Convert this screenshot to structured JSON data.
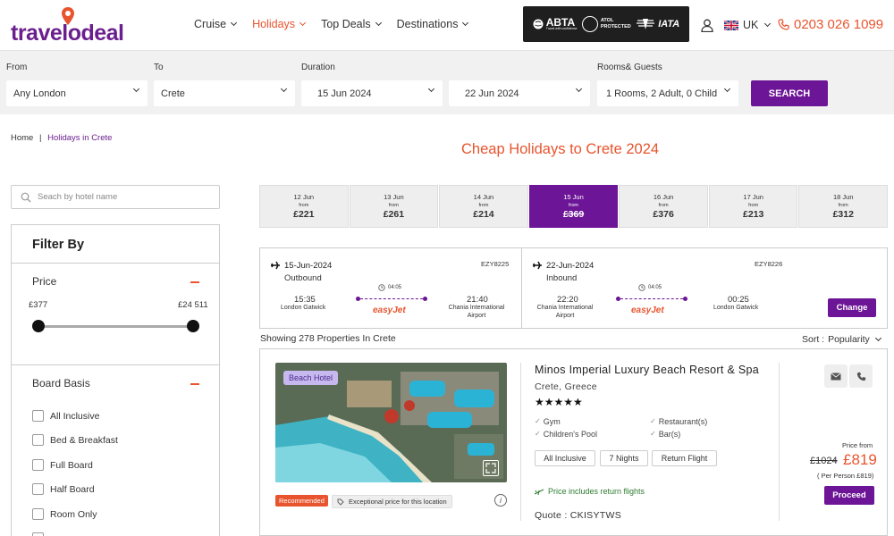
{
  "brand": {
    "logo_text": "travelodeal"
  },
  "nav": [
    {
      "label": "Cruise",
      "active": false
    },
    {
      "label": "Holidays",
      "active": true
    },
    {
      "label": "Top Deals",
      "active": false
    },
    {
      "label": "Destinations",
      "active": false
    }
  ],
  "badges": {
    "abta": "ABTA",
    "abta_sub": "Travel with confidence",
    "atol_line1": "ATOL",
    "atol_line2": "PROTECTED",
    "iata": "IATA"
  },
  "region": "UK",
  "phone": "0203 026 1099",
  "search": {
    "from_label": "From",
    "from_value": "Any London",
    "to_label": "To",
    "to_value": "Crete",
    "duration_label": "Duration",
    "depart_value": "15 Jun 2024",
    "return_value": "22 Jun 2024",
    "rooms_label": "Rooms& Guests",
    "rooms_value": "1 Rooms, 2 Adult, 0 Child",
    "button": "SEARCH"
  },
  "breadcrumb": {
    "home": "Home",
    "sep": "|",
    "current": "Holidays in Crete"
  },
  "hotel_search_placeholder": "Seach by hotel name",
  "filters": {
    "title": "Filter By",
    "price_title": "Price",
    "price_min": "£377",
    "price_max": "£24 511",
    "board_title": "Board Basis",
    "board_options": [
      "All Inclusive",
      "Bed & Breakfast",
      "Full Board",
      "Half Board",
      "Room Only"
    ]
  },
  "page_title": "Cheap Holidays to Crete 2024",
  "dates": [
    {
      "date": "12 Jun",
      "from": "from",
      "price": "£221",
      "active": false
    },
    {
      "date": "13 Jun",
      "from": "from",
      "price": "£261",
      "active": false
    },
    {
      "date": "14 Jun",
      "from": "from",
      "price": "£214",
      "active": false
    },
    {
      "date": "15 Jun",
      "from": "from",
      "price": "£369",
      "active": true
    },
    {
      "date": "16 Jun",
      "from": "from",
      "price": "£376",
      "active": false
    },
    {
      "date": "17 Jun",
      "from": "from",
      "price": "£213",
      "active": false
    },
    {
      "date": "18 Jun",
      "from": "from",
      "price": "£312",
      "active": false
    }
  ],
  "outbound": {
    "date": "15-Jun-2024",
    "direction": "Outbound",
    "code": "EZY8225",
    "dep_time": "15:35",
    "dep_place": "London Gatwick",
    "duration": "04:05",
    "airline": "easyJet",
    "arr_time": "21:40",
    "arr_place_1": "Chania International",
    "arr_place_2": "Airport"
  },
  "inbound": {
    "date": "22-Jun-2024",
    "direction": "Inbound",
    "code": "EZY8226",
    "dep_time": "22:20",
    "dep_place_1": "Chania International",
    "dep_place_2": "Airport",
    "duration": "04:05",
    "airline": "easyJet",
    "arr_time": "00:25",
    "arr_place": "London Gatwick",
    "change": "Change"
  },
  "results": {
    "showing": "Showing 278 Properties In Crete",
    "sort_label": "Sort :",
    "sort_value": "Popularity"
  },
  "hotel": {
    "tag": "Beach Hotel",
    "recommended": "Recommended",
    "exceptional": "Exceptional price for this location",
    "name": "Minos Imperial Luxury Beach Resort & Spa",
    "location": "Crete, Greece",
    "stars": "★★★★★",
    "amenities": [
      "Gym",
      "Restaurant(s)",
      "Children's Pool",
      "Bar(s)"
    ],
    "pills": [
      "All Inclusive",
      "7 Nights",
      "Return Flight"
    ],
    "flights_included": "Price includes return flights",
    "quote": "Quote : CKISYTWS",
    "price_from": "Price from",
    "price_old": "£1024",
    "price_new": "£819",
    "per_person": "( Per Person £819)",
    "proceed": "Proceed"
  }
}
